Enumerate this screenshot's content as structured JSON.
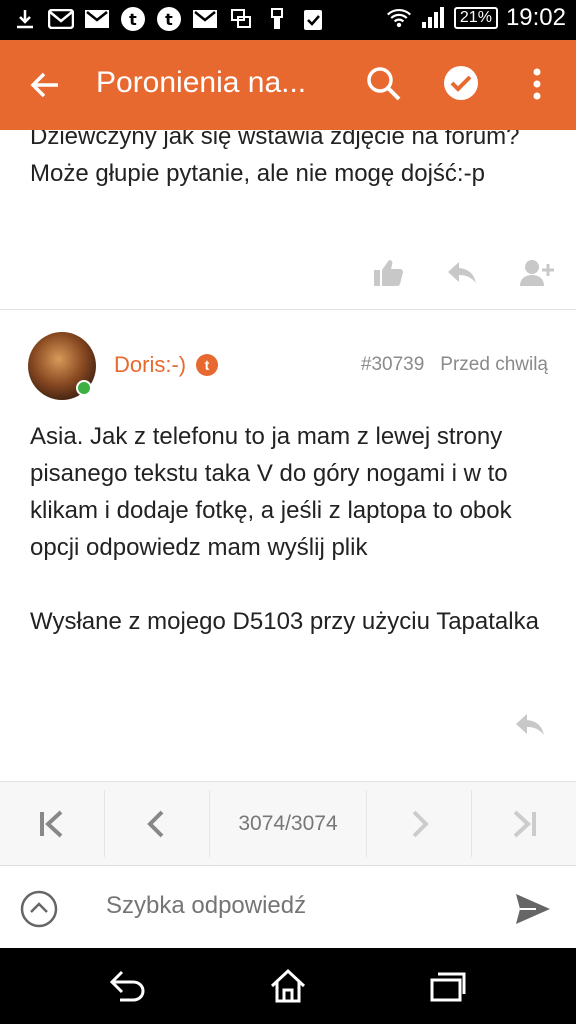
{
  "status_bar": {
    "battery": "21%",
    "time": "19:02",
    "left_icons": [
      "download-icon",
      "mail-icon",
      "mail-icon",
      "tapatalk-icon",
      "tapatalk-icon",
      "mail-icon",
      "screens-icon",
      "usb-icon",
      "clipboard-check-icon"
    ],
    "right_icons": [
      "wifi-icon",
      "signal-icon"
    ]
  },
  "app_bar": {
    "title": "Poronienia na...",
    "color": "#e8692f",
    "actions": [
      "search-icon",
      "check-circle-icon",
      "more-vert-icon"
    ]
  },
  "previous_post": {
    "text": "Dziewczyny jak się wstawia zdjęcie na forum? Może głupie pytanie, ale nie mogę dojść:-p",
    "actions": [
      "like-icon",
      "reply-icon",
      "follow-user-icon"
    ]
  },
  "post": {
    "author": "Doris:-)",
    "badge": "t",
    "post_number": "#30739",
    "time": "Przed chwilą",
    "paragraphs": [
      "Asia. Jak z telefonu to ja mam z lewej strony pisanego tekstu taka V do góry nogami i w to klikam i dodaje fotkę, a jeśli z laptopa to obok opcji odpowiedz mam wyślij plik",
      "Wysłane z mojego D5103 przy użyciu Tapatalka"
    ]
  },
  "pager": {
    "current": "3074",
    "separator": "/",
    "total": "3074"
  },
  "quick_reply": {
    "placeholder": "Szybka odpowiedź"
  }
}
